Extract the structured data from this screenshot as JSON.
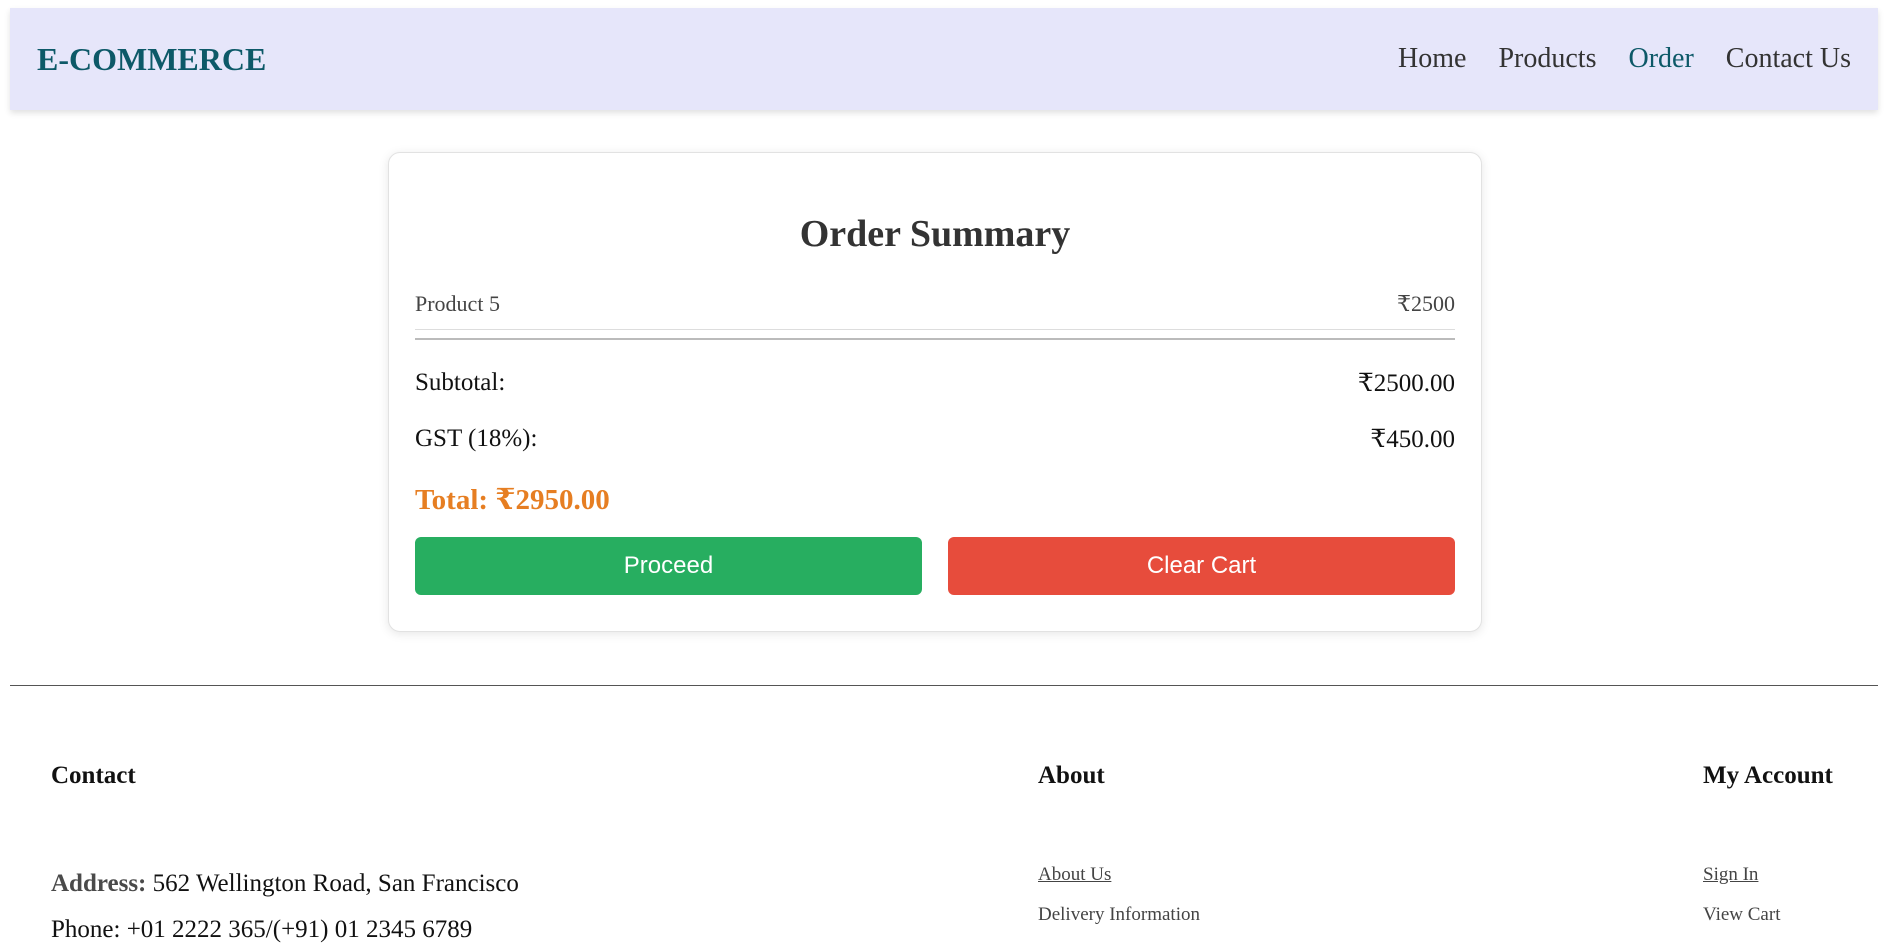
{
  "header": {
    "logo": "E-COMMERCE",
    "nav": [
      {
        "label": "Home"
      },
      {
        "label": "Products"
      },
      {
        "label": "Order"
      },
      {
        "label": "Contact Us"
      }
    ]
  },
  "order": {
    "title": "Order Summary",
    "item": {
      "name": "Product 5",
      "price": "₹2500"
    },
    "subtotal": {
      "label": "Subtotal:",
      "value": "₹2500.00"
    },
    "gst": {
      "label": "GST (18%):",
      "value": "₹450.00"
    },
    "total": "Total: ₹2950.00",
    "proceed": "Proceed",
    "clear": "Clear Cart"
  },
  "footer": {
    "contact": {
      "heading": "Contact",
      "address_label": "Address:",
      "address": "562 Wellington Road, San Francisco",
      "phone_partial": "Phone: +01 2222 365/(+91) 01 2345 6789"
    },
    "about": {
      "heading": "About",
      "links": [
        "About Us",
        "Delivery Information"
      ]
    },
    "account": {
      "heading": "My Account",
      "links": [
        "Sign In",
        "View Cart"
      ]
    }
  },
  "colors": {
    "header_bg": "#e6e6fa",
    "brand": "#0d5968",
    "total": "#e67e22",
    "proceed": "#27ae60",
    "clear": "#e74c3c"
  }
}
